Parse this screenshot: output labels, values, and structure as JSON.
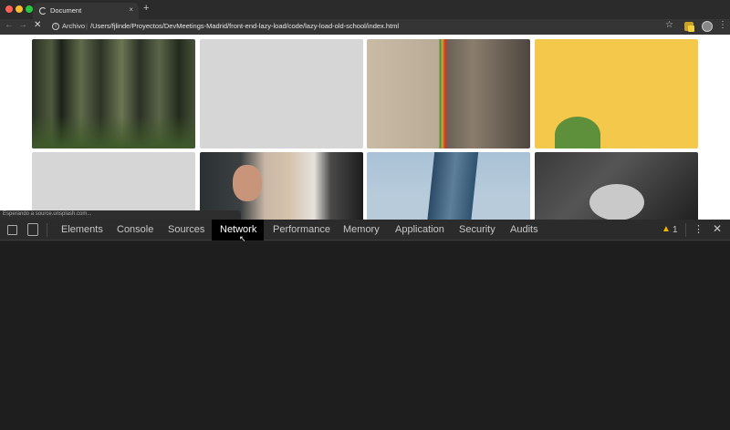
{
  "browser": {
    "tab_title": "Document",
    "new_tab_label": "+",
    "tab_close_label": "×",
    "scheme_label": "Archivo",
    "url": "/Users/fjlinde/Proyectos/DevMeetings-Madrid/front-end-lazy-load/code/lazy-load-old-school/index.html",
    "status_text": "Esperando a source.unsplash.com..."
  },
  "page": {
    "images": [
      {
        "row": 1,
        "col": 1,
        "state": "loaded",
        "subject": "forest"
      },
      {
        "row": 1,
        "col": 2,
        "state": "placeholder"
      },
      {
        "row": 1,
        "col": 3,
        "state": "loaded",
        "subject": "subway-station"
      },
      {
        "row": 1,
        "col": 4,
        "state": "loaded",
        "subject": "cactus-on-yellow"
      },
      {
        "row": 2,
        "col": 1,
        "state": "placeholder"
      },
      {
        "row": 2,
        "col": 2,
        "state": "loaded",
        "subject": "man-at-laptop"
      },
      {
        "row": 2,
        "col": 3,
        "state": "loaded",
        "subject": "skyscraper"
      },
      {
        "row": 2,
        "col": 4,
        "state": "loaded",
        "subject": "hands-holding-figurines"
      }
    ]
  },
  "devtools": {
    "tabs": [
      {
        "label": "Elements"
      },
      {
        "label": "Console"
      },
      {
        "label": "Sources"
      },
      {
        "label": "Network",
        "active": true
      },
      {
        "label": "Performance"
      },
      {
        "label": "Memory"
      },
      {
        "label": "Application"
      },
      {
        "label": "Security"
      },
      {
        "label": "Audits"
      }
    ],
    "warning_count": "1",
    "more_label": "⋮",
    "close_label": "✕"
  }
}
